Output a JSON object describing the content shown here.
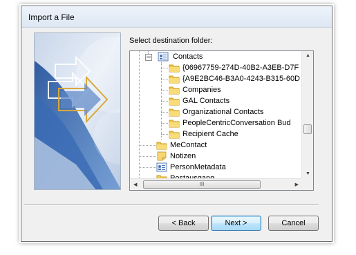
{
  "window": {
    "title": "Import a File"
  },
  "dest_label": "Select destination folder:",
  "tree": {
    "items": [
      {
        "label": "Contacts",
        "icon": "contacts-icon"
      },
      {
        "label": "{06967759-274D-40B2-A3EB-D7F",
        "icon": "folder-icon"
      },
      {
        "label": "{A9E2BC46-B3A0-4243-B315-60D",
        "icon": "folder-icon"
      },
      {
        "label": "Companies",
        "icon": "folder-icon"
      },
      {
        "label": "GAL Contacts",
        "icon": "folder-icon"
      },
      {
        "label": "Organizational Contacts",
        "icon": "folder-icon"
      },
      {
        "label": "PeopleCentricConversation Bud",
        "icon": "folder-icon"
      },
      {
        "label": "Recipient Cache",
        "icon": "folder-icon"
      },
      {
        "label": "MeContact",
        "icon": "folder-icon"
      },
      {
        "label": "Notizen",
        "icon": "notes-icon"
      },
      {
        "label": "PersonMetadata",
        "icon": "contacts-icon"
      },
      {
        "label": "Postausgang",
        "icon": "folder-icon"
      }
    ],
    "hscroll_grip": "III"
  },
  "buttons": {
    "back": "< Back",
    "next": "Next >",
    "cancel": "Cancel"
  },
  "colors": {
    "folder": "#f2c94c",
    "accent": "#3c7fb1"
  }
}
